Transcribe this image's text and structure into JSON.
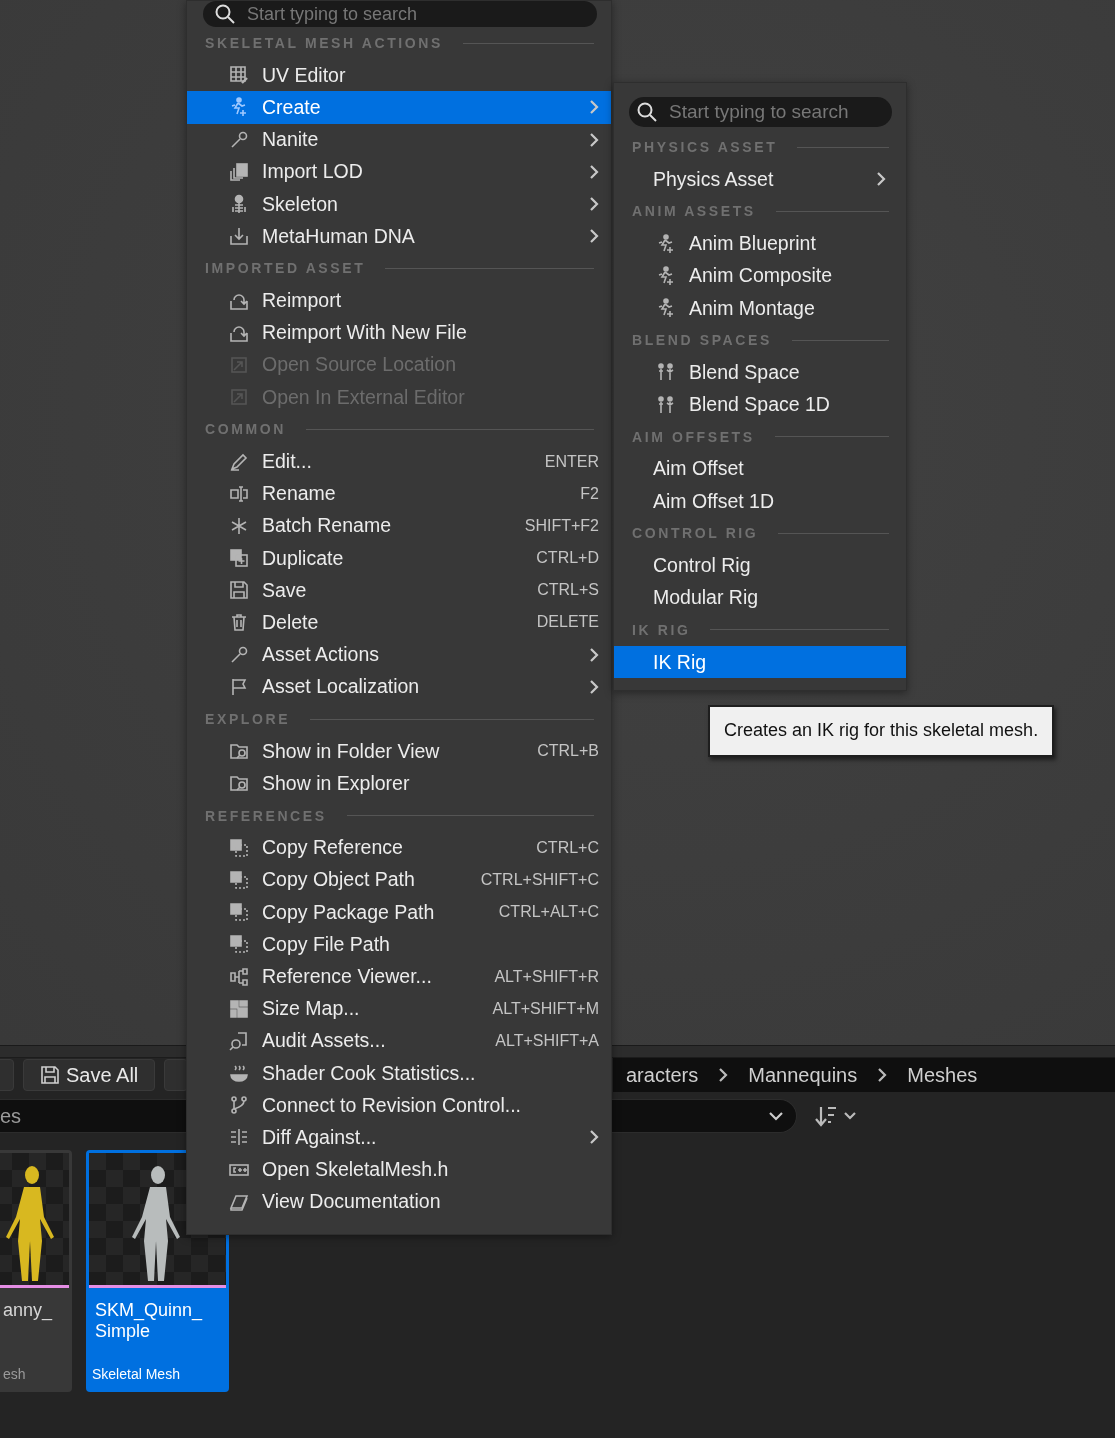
{
  "main_menu": {
    "search": {
      "placeholder": "Start typing to search"
    },
    "sections": [
      {
        "title": "SKELETAL MESH ACTIONS",
        "items": [
          {
            "label": "UV Editor",
            "selected": false,
            "disabled": false,
            "submenu": false
          },
          {
            "label": "Create",
            "selected": true,
            "disabled": false,
            "submenu": true
          },
          {
            "label": "Nanite",
            "selected": false,
            "disabled": false,
            "submenu": true
          },
          {
            "label": "Import LOD",
            "selected": false,
            "disabled": false,
            "submenu": true
          },
          {
            "label": "Skeleton",
            "selected": false,
            "disabled": false,
            "submenu": true
          },
          {
            "label": "MetaHuman DNA",
            "selected": false,
            "disabled": false,
            "submenu": true
          }
        ]
      },
      {
        "title": "IMPORTED ASSET",
        "items": [
          {
            "label": "Reimport",
            "selected": false,
            "disabled": false,
            "submenu": false
          },
          {
            "label": "Reimport With New File",
            "selected": false,
            "disabled": false,
            "submenu": false
          },
          {
            "label": "Open Source Location",
            "selected": false,
            "disabled": true,
            "submenu": false
          },
          {
            "label": "Open In External Editor",
            "selected": false,
            "disabled": true,
            "submenu": false
          }
        ]
      },
      {
        "title": "COMMON",
        "items": [
          {
            "label": "Edit...",
            "shortcut": "ENTER",
            "selected": false,
            "disabled": false,
            "submenu": false
          },
          {
            "label": "Rename",
            "shortcut": "F2",
            "selected": false,
            "disabled": false,
            "submenu": false
          },
          {
            "label": "Batch Rename",
            "shortcut": "SHIFT+F2",
            "selected": false,
            "disabled": false,
            "submenu": false
          },
          {
            "label": "Duplicate",
            "shortcut": "CTRL+D",
            "selected": false,
            "disabled": false,
            "submenu": false
          },
          {
            "label": "Save",
            "shortcut": "CTRL+S",
            "selected": false,
            "disabled": false,
            "submenu": false
          },
          {
            "label": "Delete",
            "shortcut": "DELETE",
            "selected": false,
            "disabled": false,
            "submenu": false
          },
          {
            "label": "Asset Actions",
            "selected": false,
            "disabled": false,
            "submenu": true
          },
          {
            "label": "Asset Localization",
            "selected": false,
            "disabled": false,
            "submenu": true
          }
        ]
      },
      {
        "title": "EXPLORE",
        "items": [
          {
            "label": "Show in Folder View",
            "shortcut": "CTRL+B",
            "selected": false,
            "disabled": false,
            "submenu": false
          },
          {
            "label": "Show in Explorer",
            "selected": false,
            "disabled": false,
            "submenu": false
          }
        ]
      },
      {
        "title": "REFERENCES",
        "items": [
          {
            "label": "Copy Reference",
            "shortcut": "CTRL+C",
            "selected": false,
            "disabled": false,
            "submenu": false
          },
          {
            "label": "Copy Object Path",
            "shortcut": "CTRL+SHIFT+C",
            "selected": false,
            "disabled": false,
            "submenu": false
          },
          {
            "label": "Copy Package Path",
            "shortcut": "CTRL+ALT+C",
            "selected": false,
            "disabled": false,
            "submenu": false
          },
          {
            "label": "Copy File Path",
            "selected": false,
            "disabled": false,
            "submenu": false
          },
          {
            "label": "Reference Viewer...",
            "shortcut": "ALT+SHIFT+R",
            "selected": false,
            "disabled": false,
            "submenu": false
          },
          {
            "label": "Size Map...",
            "shortcut": "ALT+SHIFT+M",
            "selected": false,
            "disabled": false,
            "submenu": false
          },
          {
            "label": "Audit Assets...",
            "shortcut": "ALT+SHIFT+A",
            "selected": false,
            "disabled": false,
            "submenu": false
          },
          {
            "label": "Shader Cook Statistics...",
            "selected": false,
            "disabled": false,
            "submenu": false
          },
          {
            "label": "Connect to Revision Control...",
            "selected": false,
            "disabled": false,
            "submenu": false
          },
          {
            "label": "Diff Against...",
            "selected": false,
            "disabled": false,
            "submenu": true
          },
          {
            "label": "Open SkeletalMesh.h",
            "selected": false,
            "disabled": false,
            "submenu": false
          },
          {
            "label": "View Documentation",
            "selected": false,
            "disabled": false,
            "submenu": false
          }
        ]
      }
    ]
  },
  "submenu": {
    "search": {
      "placeholder": "Start typing to search"
    },
    "sections": [
      {
        "title": "PHYSICS ASSET",
        "items": [
          {
            "label": "Physics Asset",
            "selected": false,
            "submenu": true
          }
        ]
      },
      {
        "title": "ANIM ASSETS",
        "items": [
          {
            "label": "Anim Blueprint",
            "selected": false,
            "submenu": false
          },
          {
            "label": "Anim Composite",
            "selected": false,
            "submenu": false
          },
          {
            "label": "Anim Montage",
            "selected": false,
            "submenu": false
          }
        ]
      },
      {
        "title": "BLEND SPACES",
        "items": [
          {
            "label": "Blend Space",
            "selected": false,
            "submenu": false
          },
          {
            "label": "Blend Space 1D",
            "selected": false,
            "submenu": false
          }
        ]
      },
      {
        "title": "AIM OFFSETS",
        "items": [
          {
            "label": "Aim Offset",
            "selected": false,
            "submenu": false
          },
          {
            "label": "Aim Offset 1D",
            "selected": false,
            "submenu": false
          }
        ]
      },
      {
        "title": "CONTROL RIG",
        "items": [
          {
            "label": "Control Rig",
            "selected": false,
            "submenu": false
          },
          {
            "label": "Modular Rig",
            "selected": false,
            "submenu": false
          }
        ]
      },
      {
        "title": "IK RIG",
        "items": [
          {
            "label": "IK Rig",
            "selected": true,
            "submenu": false
          }
        ]
      }
    ]
  },
  "tooltip": {
    "text": "Creates an IK rig for this skeletal mesh."
  },
  "content_browser": {
    "toolbar": {
      "buttons": [
        {
          "label": "Save All"
        }
      ]
    },
    "breadcrumbs": [
      "aracters",
      "Mannequins",
      "Meshes"
    ],
    "search": {
      "value": "es"
    },
    "assets": [
      {
        "name": "anny_",
        "type": "esh",
        "selected": false
      },
      {
        "name": "SKM_Quinn_Simple",
        "type": "Skeletal Mesh",
        "selected": true
      }
    ]
  }
}
